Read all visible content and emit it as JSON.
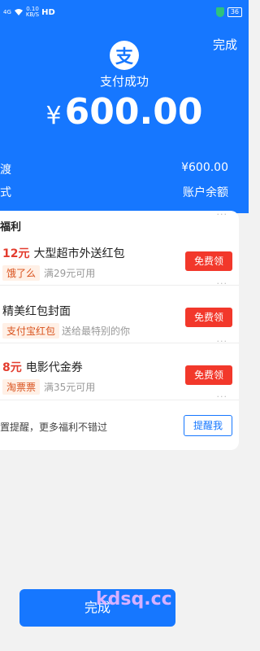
{
  "status_bar": {
    "signal": "4G",
    "speed_value": "0.10",
    "speed_unit": "KB/S",
    "hd": "HD",
    "battery": "36"
  },
  "header": {
    "done_label": "完成",
    "logo_char": "支",
    "title": "支付成功",
    "currency": "¥",
    "amount": "600.00"
  },
  "summary": {
    "rows": [
      {
        "label": "渡",
        "value": "¥600.00"
      },
      {
        "label": "式",
        "value": "账户余额"
      }
    ]
  },
  "benefits": {
    "title": "福利",
    "items": [
      {
        "price": "12元",
        "title": "大型超市外送红包",
        "tag": "饿了么",
        "desc": "满29元可用",
        "button": "免费领"
      },
      {
        "price": "",
        "title": "精美红包封面",
        "tag": "支付宝红包",
        "desc": "送给最特别的你",
        "button": "免费领"
      },
      {
        "price": "8元",
        "title": "电影代金券",
        "tag": "淘票票",
        "desc": "满35元可用",
        "button": "免费领"
      }
    ],
    "remind_text": "置提醒，更多福利不错过",
    "remind_button": "提醒我"
  },
  "footer": {
    "done_label": "完成"
  },
  "watermark": "kdsq.cc",
  "colors": {
    "brand_blue": "#1677ff",
    "button_red": "#f2382b",
    "price_red": "#e33d2f"
  }
}
